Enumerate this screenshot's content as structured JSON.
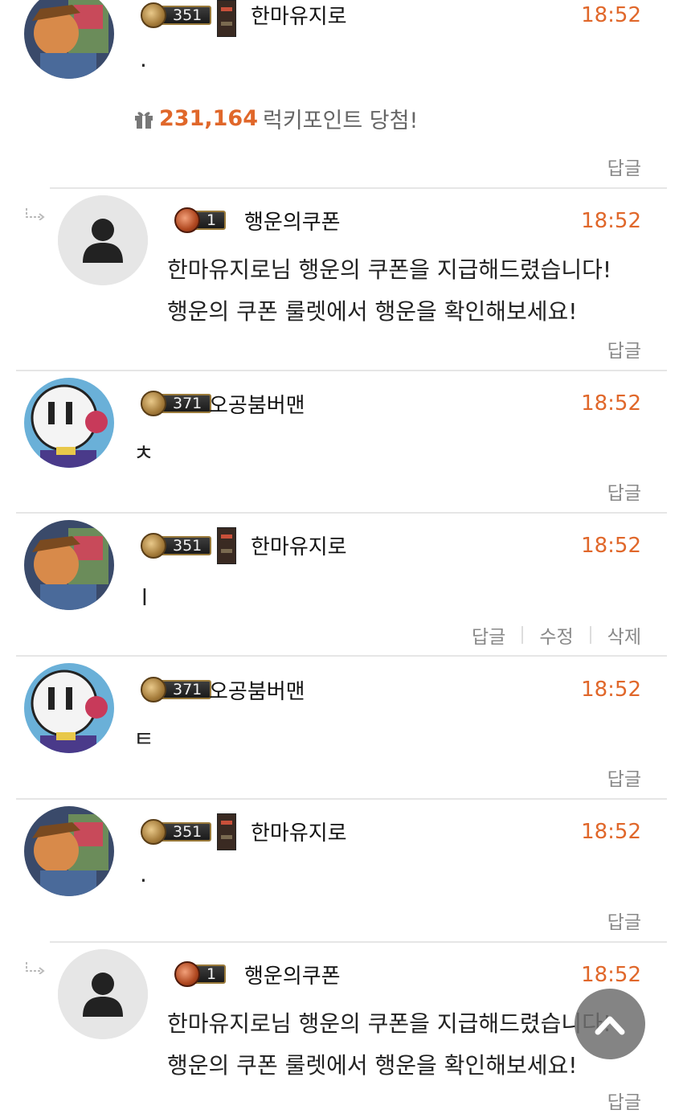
{
  "comments": [
    {
      "user": "한마유지로",
      "level": "351",
      "time": "18:52",
      "text": "·",
      "lucky_points": "231,164",
      "lucky_label": "럭키포인트 당첨!",
      "actions": [
        "답글"
      ]
    },
    {
      "user": "행운의쿠폰",
      "level": "1",
      "time": "18:52",
      "lines": [
        "한마유지로님 행운의 쿠폰을 지급해드렸습니다!",
        "행운의 쿠폰 룰렛에서 행운을 확인해보세요!"
      ],
      "actions": [
        "답글"
      ],
      "is_reply": true
    },
    {
      "user": "오공붐버맨",
      "level": "371",
      "time": "18:52",
      "text": "ㅊ",
      "actions": [
        "답글"
      ]
    },
    {
      "user": "한마유지로",
      "level": "351",
      "time": "18:52",
      "text": "l",
      "actions": [
        "답글",
        "수정",
        "삭제"
      ]
    },
    {
      "user": "오공붐버맨",
      "level": "371",
      "time": "18:52",
      "text": "ㅌ",
      "actions": [
        "답글"
      ]
    },
    {
      "user": "한마유지로",
      "level": "351",
      "time": "18:52",
      "text": "·",
      "actions": [
        "답글"
      ]
    },
    {
      "user": "행운의쿠폰",
      "level": "1",
      "time": "18:52",
      "lines": [
        "한마유지로님 행운의 쿠폰을 지급해드렸습니다!",
        "행운의 쿠폰 룰렛에서 행운을 확인해보세요!"
      ],
      "actions": [
        "답글"
      ],
      "is_reply": true
    }
  ],
  "icons": {
    "gift": "gift-icon",
    "reply_arrow": "reply-arrow-icon",
    "scroll_top": "chevron-up-icon",
    "default_avatar": "user-silhouette-icon"
  },
  "colors": {
    "time": "#e0672a",
    "lucky_points": "#e0672a"
  }
}
